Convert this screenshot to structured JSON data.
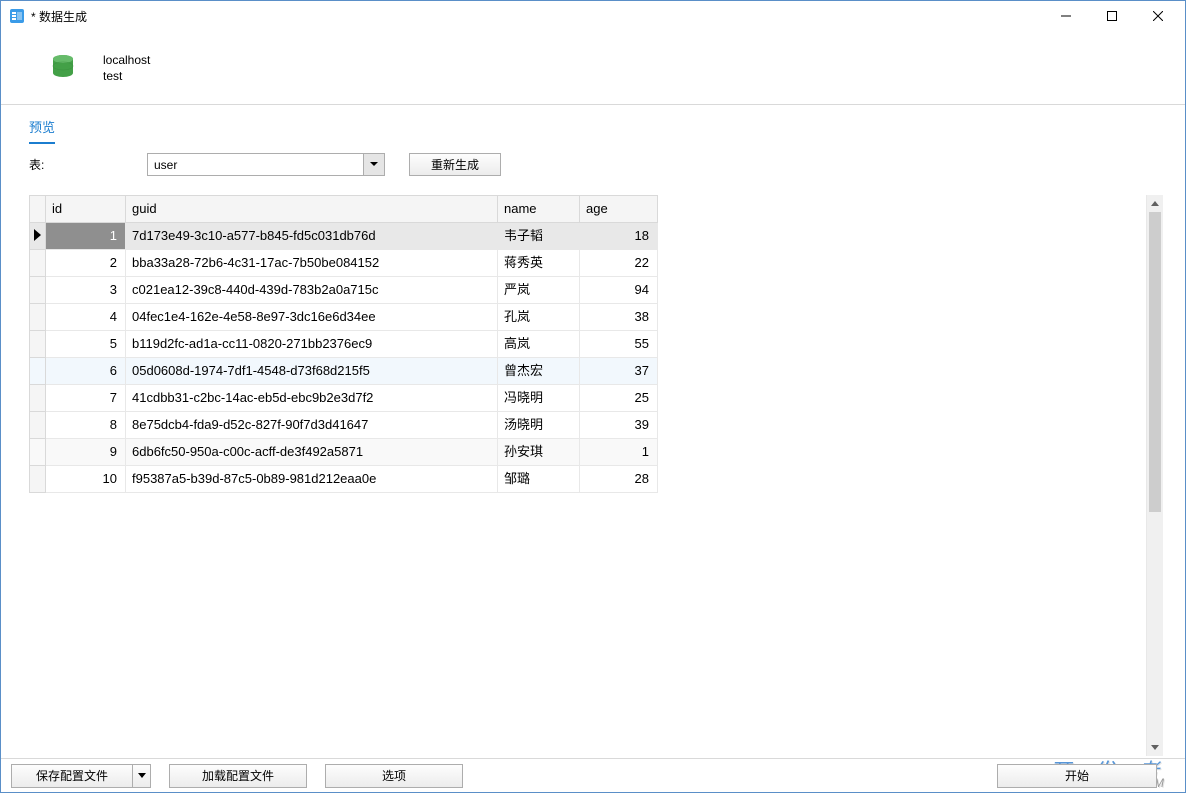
{
  "window": {
    "title": "* 数据生成"
  },
  "connection": {
    "host": "localhost",
    "database": "test"
  },
  "tab": {
    "preview": "预览"
  },
  "toolbar": {
    "table_label": "表:",
    "table_value": "user",
    "regenerate": "重新生成"
  },
  "columns": {
    "id": "id",
    "guid": "guid",
    "name": "name",
    "age": "age"
  },
  "rows": [
    {
      "id": "1",
      "guid": "7d173e49-3c10-a577-b845-fd5c031db76d",
      "name": "韦子韬",
      "age": "18"
    },
    {
      "id": "2",
      "guid": "bba33a28-72b6-4c31-17ac-7b50be084152",
      "name": "蒋秀英",
      "age": "22"
    },
    {
      "id": "3",
      "guid": "c021ea12-39c8-440d-439d-783b2a0a715c",
      "name": "严岚",
      "age": "94"
    },
    {
      "id": "4",
      "guid": "04fec1e4-162e-4e58-8e97-3dc16e6d34ee",
      "name": "孔岚",
      "age": "38"
    },
    {
      "id": "5",
      "guid": "b119d2fc-ad1a-cc11-0820-271bb2376ec9",
      "name": "高岚",
      "age": "55"
    },
    {
      "id": "6",
      "guid": "05d0608d-1974-7df1-4548-d73f68d215f5",
      "name": "曾杰宏",
      "age": "37"
    },
    {
      "id": "7",
      "guid": "41cdbb31-c2bc-14ac-eb5d-ebc9b2e3d7f2",
      "name": "冯晓明",
      "age": "25"
    },
    {
      "id": "8",
      "guid": "8e75dcb4-fda9-d52c-827f-90f7d3d41647",
      "name": "汤晓明",
      "age": "39"
    },
    {
      "id": "9",
      "guid": "6db6fc50-950a-c00c-acff-de3f492a5871",
      "name": "孙安琪",
      "age": "1"
    },
    {
      "id": "10",
      "guid": "f95387a5-b39d-87c5-0b89-981d212eaa0e",
      "name": "邹璐",
      "age": "28"
    }
  ],
  "bottom": {
    "save_config": "保存配置文件",
    "load_config": "加载配置文件",
    "options": "选项",
    "start": "开始"
  },
  "watermark": {
    "main": "开 发 者",
    "sub": "DevZe.CoM"
  }
}
